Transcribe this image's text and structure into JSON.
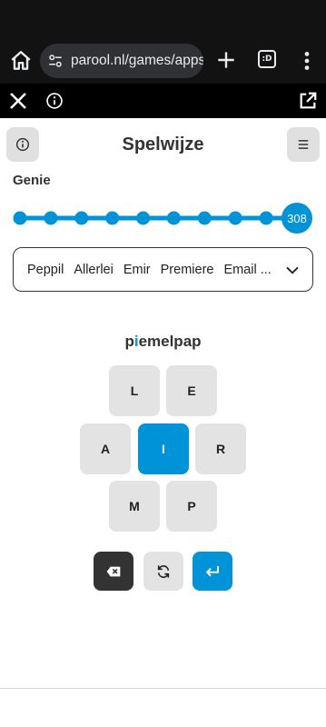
{
  "browser": {
    "url": "parool.nl/games/apps/",
    "tabs_badge": ":D"
  },
  "header": {
    "title": "Spelwijze"
  },
  "rank": {
    "label": "Genie",
    "score": "308",
    "progress_fraction": 1.0,
    "dots": 9
  },
  "found_words": [
    "Peppil",
    "Allerlei",
    "Emir",
    "Premiere",
    "Email ..."
  ],
  "current_input": {
    "prefix": "p",
    "highlight": "i",
    "suffix": "emelpap"
  },
  "letters": {
    "top_left": "L",
    "top_right": "E",
    "left": "A",
    "center": "I",
    "right": "R",
    "bottom_left": "M",
    "bottom_right": "P"
  },
  "colors": {
    "accent": "#0093d8",
    "tile": "#e3e3e3",
    "delete_button": "#333333"
  },
  "icons": {
    "delete": "backspace-icon",
    "shuffle": "shuffle-icon",
    "enter": "enter-icon"
  }
}
